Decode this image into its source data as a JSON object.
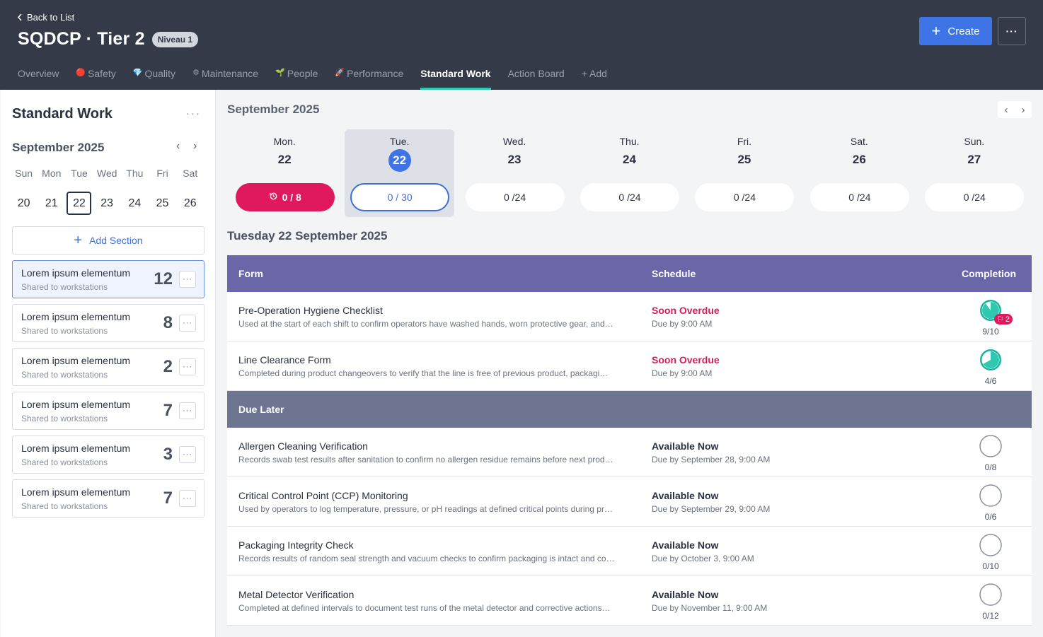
{
  "header": {
    "back_label": "Back to List",
    "title": "SQDCP · Tier 2",
    "badge": "Niveau 1",
    "create_label": "Create",
    "more_label": "···",
    "tabs": [
      {
        "label": "Overview",
        "icon": ""
      },
      {
        "label": "Safety",
        "icon": "🔴"
      },
      {
        "label": "Quality",
        "icon": "💎"
      },
      {
        "label": "Maintenance",
        "icon": "⚙"
      },
      {
        "label": "People",
        "icon": "🌱"
      },
      {
        "label": "Performance",
        "icon": "🚀"
      },
      {
        "label": "Standard Work",
        "icon": ""
      },
      {
        "label": "Action Board",
        "icon": ""
      },
      {
        "label": "+ Add",
        "icon": ""
      }
    ],
    "active_tab": "Standard Work"
  },
  "sidebar": {
    "title": "Standard Work",
    "more_label": "···",
    "month": "September 2025",
    "weekdays": [
      "Sun",
      "Mon",
      "Tue",
      "Wed",
      "Thu",
      "Fri",
      "Sat"
    ],
    "days": [
      "20",
      "21",
      "22",
      "23",
      "24",
      "25",
      "26"
    ],
    "selected_day": "22",
    "add_section_label": "Add Section",
    "sections": [
      {
        "name": "Lorem ipsum elementum",
        "sub": "Shared to workstations",
        "count": "12"
      },
      {
        "name": "Lorem ipsum elementum",
        "sub": "Shared to workstations",
        "count": "8"
      },
      {
        "name": "Lorem ipsum elementum",
        "sub": "Shared to workstations",
        "count": "2"
      },
      {
        "name": "Lorem ipsum elementum",
        "sub": "Shared to workstations",
        "count": "7"
      },
      {
        "name": "Lorem ipsum elementum",
        "sub": "Shared to workstations",
        "count": "3"
      },
      {
        "name": "Lorem ipsum elementum",
        "sub": "Shared to workstations",
        "count": "7"
      }
    ]
  },
  "main": {
    "month": "September 2025",
    "week": [
      {
        "name": "Mon.",
        "num": "22",
        "pill": "0 / 8",
        "state": "overdue"
      },
      {
        "name": "Tue.",
        "num": "22",
        "pill": "0 / 30",
        "state": "current"
      },
      {
        "name": "Wed.",
        "num": "23",
        "pill": "0 /24",
        "state": ""
      },
      {
        "name": "Thu.",
        "num": "24",
        "pill": "0 /24",
        "state": ""
      },
      {
        "name": "Fri.",
        "num": "25",
        "pill": "0 /24",
        "state": ""
      },
      {
        "name": "Sat.",
        "num": "26",
        "pill": "0 /24",
        "state": ""
      },
      {
        "name": "Sun.",
        "num": "27",
        "pill": "0 /24",
        "state": ""
      }
    ],
    "day_title": "Tuesday 22 September 2025",
    "columns": {
      "form": "Form",
      "schedule": "Schedule",
      "completion": "Completion"
    },
    "rows_top": [
      {
        "name": "Pre-Operation Hygiene Checklist",
        "desc": "Used at the start of each shift to confirm operators have washed hands, worn protective gear, and…",
        "status": "Soon Overdue",
        "due": "Due by 9:00 AM",
        "completion": "9/10",
        "fraction": 0.9,
        "flag": "2"
      },
      {
        "name": "Line Clearance Form",
        "desc": "Completed during product changeovers to verify that the line is free of previous product, packagi…",
        "status": "Soon Overdue",
        "due": "Due by 9:00 AM",
        "completion": "4/6",
        "fraction": 0.67,
        "flag": ""
      }
    ],
    "group_label": "Due Later",
    "rows_later": [
      {
        "name": "Allergen Cleaning Verification",
        "desc": "Records swab test results after sanitation to confirm no allergen residue remains before next prod…",
        "status": "Available Now",
        "due": "Due by September 28, 9:00 AM",
        "completion": "0/8",
        "fraction": 0
      },
      {
        "name": "Critical Control Point (CCP) Monitoring",
        "desc": "Used by operators to log temperature, pressure, or pH readings at defined critical points during pr…",
        "status": "Available Now",
        "due": "Due by September 29, 9:00 AM",
        "completion": "0/6",
        "fraction": 0
      },
      {
        "name": "Packaging Integrity Check",
        "desc": "Records results of random seal strength and vacuum checks to confirm packaging is intact and co…",
        "status": "Available Now",
        "due": "Due by October 3, 9:00 AM",
        "completion": "0/10",
        "fraction": 0
      },
      {
        "name": "Metal Detector Verification",
        "desc": "Completed at defined intervals to document test runs of the metal detector and corrective actions…",
        "status": "Available Now",
        "due": "Due by November 11, 9:00 AM",
        "completion": "0/12",
        "fraction": 0
      }
    ]
  },
  "colors": {
    "accent": "#3f74e6",
    "overdue": "#e0195e",
    "teal": "#2fc9b0",
    "header": "#343a48"
  }
}
